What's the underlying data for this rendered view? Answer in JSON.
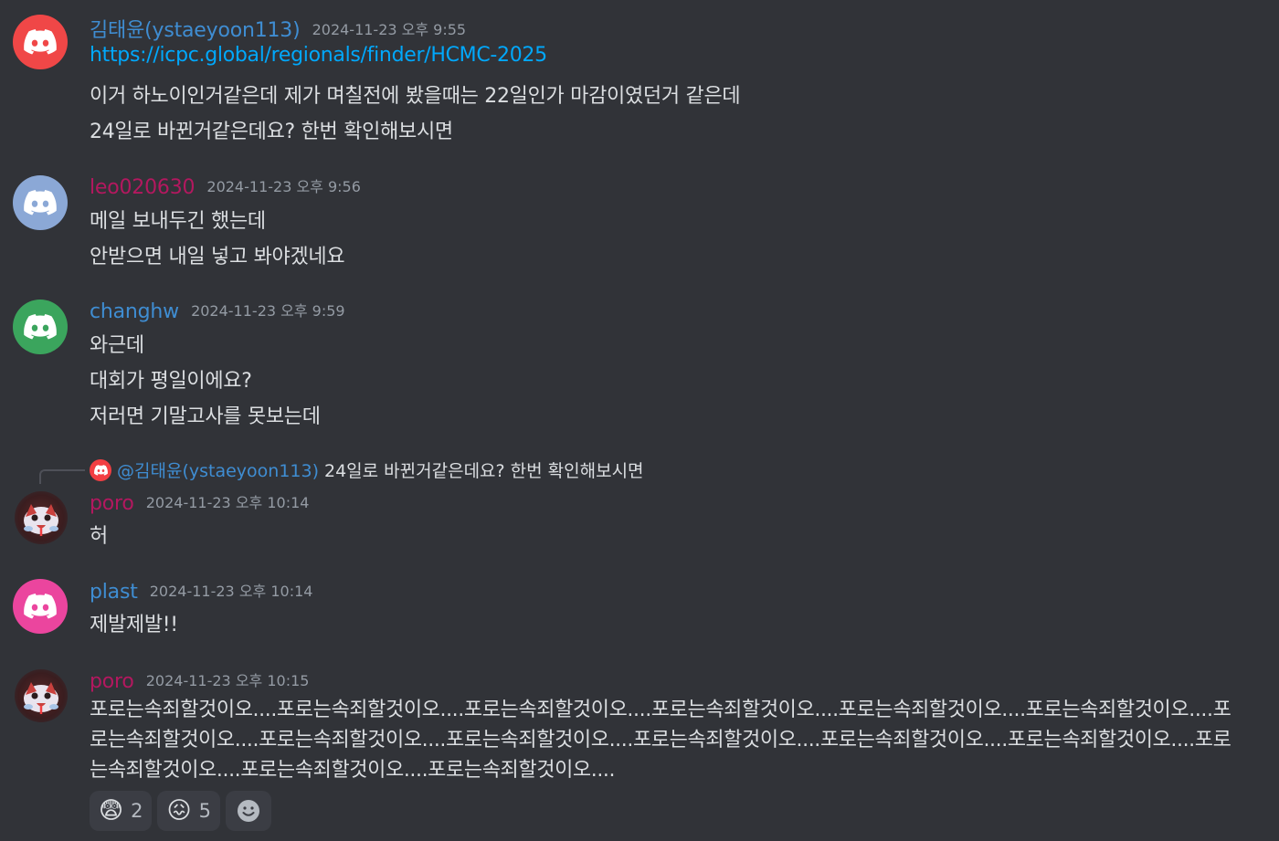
{
  "colors": {
    "background": "#313338",
    "text": "#dbdee1",
    "timestamp": "#949ba4",
    "link": "#00a8fc",
    "avatar_red": "#f04747",
    "avatar_lightblue": "#8ba8d6",
    "avatar_green": "#3ba55d",
    "avatar_pink": "#eb459e",
    "name_blue": "#3f8dd2",
    "name_magenta": "#b3185f"
  },
  "messages": [
    {
      "author": "김태윤(ystaeyoon113)",
      "timestamp": "2024-11-23 오후 9:55",
      "avatar_icon": "discord-logo-icon",
      "lines": [
        "https://icpc.global/regionals/finder/HCMC-2025",
        "이거 하노이인거같은데 제가 며칠전에 봤을때는 22일인가 마감이였던거 같은데",
        "24일로 바뀐거같은데요? 한번 확인해보시면"
      ]
    },
    {
      "author": "leo020630",
      "timestamp": "2024-11-23 오후 9:56",
      "avatar_icon": "discord-logo-icon",
      "lines": [
        "메일 보내두긴 했는데",
        "안받으면 내일 넣고 봐야겠네요"
      ]
    },
    {
      "author": "changhw",
      "timestamp": "2024-11-23 오후 9:59",
      "avatar_icon": "discord-logo-icon",
      "lines": [
        "와근데",
        "대회가 평일이에요?",
        "저러면 기말고사를 못보는데"
      ]
    },
    {
      "reply": {
        "mention": "@김태윤(ystaeyoon113)",
        "quote": "24일로 바뀐거같은데요? 한번 확인해보시면"
      },
      "author": "poro",
      "timestamp": "2024-11-23 오후 10:14",
      "avatar_icon": "poro-avatar-icon",
      "lines": [
        "허"
      ]
    },
    {
      "author": "plast",
      "timestamp": "2024-11-23 오후 10:14",
      "avatar_icon": "discord-logo-icon",
      "lines": [
        "제발제발!!"
      ]
    },
    {
      "author": "poro",
      "timestamp": "2024-11-23 오후 10:15",
      "avatar_icon": "poro-avatar-icon",
      "text": "포로는속죄할것이오....포로는속죄할것이오....포로는속죄할것이오....포로는속죄할것이오....포로는속죄할것이오....포로는속죄할것이오....포로는속죄할것이오....포로는속죄할것이오....포로는속죄할것이오....포로는속죄할것이오....포로는속죄할것이오....포로는속죄할것이오....포로는속죄할것이오....포로는속죄할것이오....포로는속죄할것이오....",
      "reactions": [
        {
          "emoji": "😨",
          "icon": "anxious-face-icon",
          "count": "2"
        },
        {
          "emoji": "😖",
          "icon": "confounded-face-icon",
          "count": "5"
        }
      ],
      "add_reaction_icon": "add-reaction-icon"
    }
  ]
}
